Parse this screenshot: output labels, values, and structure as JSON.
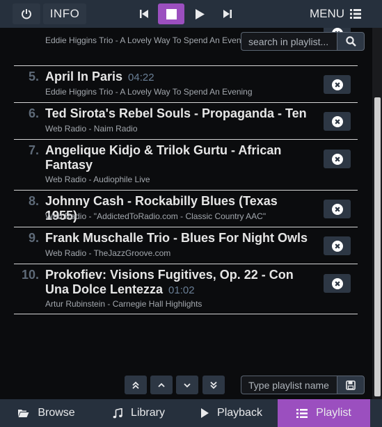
{
  "header": {
    "info_label": "INFO",
    "menu_label": "MENU",
    "icons": [
      "power-icon",
      "skip-back-icon",
      "stop-icon",
      "play-icon",
      "skip-forward-icon",
      "list-icon"
    ],
    "accent": "#9b4fbf"
  },
  "search": {
    "placeholder": "search in playlist..."
  },
  "playlist": {
    "partial_row_sub": "Eddie Higgins Trio - A Lovely Way To Spend An Evening",
    "items": [
      {
        "num": "5.",
        "title": "April In Paris",
        "duration": "04:22",
        "sub": "Eddie Higgins Trio - A Lovely Way To Spend An Evening"
      },
      {
        "num": "6.",
        "title": "Ted Sirota's Rebel Souls - Propaganda - Ten",
        "duration": "",
        "sub": "Web Radio - Naim Radio"
      },
      {
        "num": "7.",
        "title": "Angelique Kidjo & Trilok Gurtu - African Fantasy",
        "duration": "",
        "sub": "Web Radio - Audiophile Live"
      },
      {
        "num": "8.",
        "title": "Johnny Cash - Rockabilly Blues (Texas 1955)",
        "duration": "",
        "sub": "Web Radio - \"AddictedToRadio.com - Classic Country AAC\""
      },
      {
        "num": "9.",
        "title": "Frank Muschalle Trio - Blues For Night Owls",
        "duration": "",
        "sub": "Web Radio - TheJazzGroove.com"
      },
      {
        "num": "10.",
        "title": "Prokofiev: Visions Fugitives, Op. 22 - Con Una Dolce Lentezza",
        "duration": "01:02",
        "sub": "Artur Rubinstein - Carnegie Hall Highlights"
      }
    ]
  },
  "save": {
    "placeholder": "Type playlist name"
  },
  "tabs": [
    {
      "label": "Browse",
      "icon": "folder-open-icon"
    },
    {
      "label": "Library",
      "icon": "music-note-icon"
    },
    {
      "label": "Playback",
      "icon": "play-icon"
    },
    {
      "label": "Playlist",
      "icon": "list-icon",
      "active": true
    }
  ]
}
